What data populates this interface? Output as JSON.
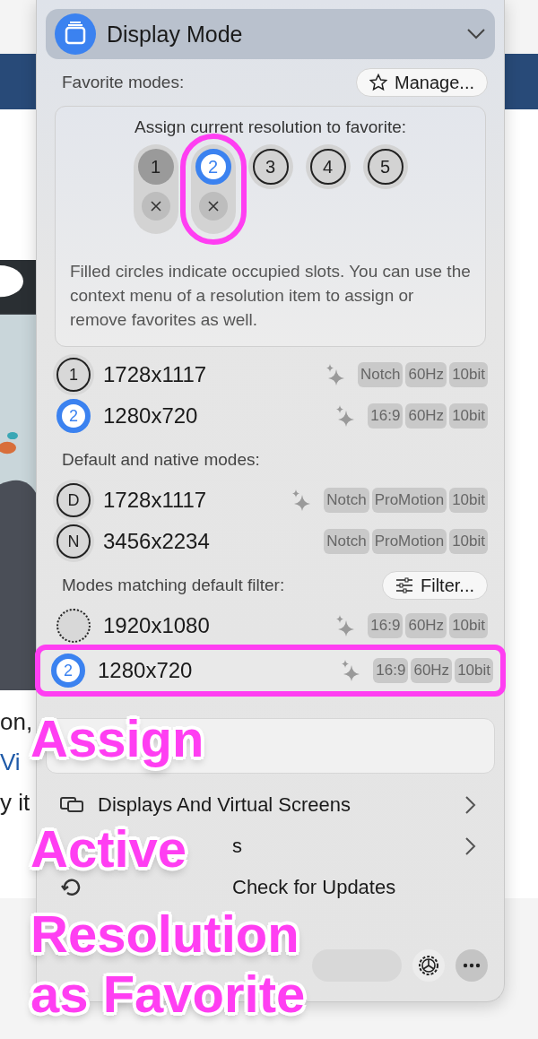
{
  "background": {
    "texts": [
      {
        "text": "on,",
        "kind": "plain"
      },
      {
        "text": "Vi",
        "kind": "link"
      },
      {
        "text": "y it",
        "kind": "plain"
      }
    ]
  },
  "header": {
    "title": "Display Mode",
    "expanded": true
  },
  "favorites": {
    "label": "Favorite modes:",
    "manage_button": "Manage...",
    "assign_title": "Assign current resolution to favorite:",
    "slots": [
      {
        "number": "1",
        "occupied": true,
        "selected": false,
        "highlighted": false
      },
      {
        "number": "2",
        "occupied": true,
        "selected": true,
        "highlighted": true
      },
      {
        "number": "3",
        "occupied": false,
        "selected": false,
        "highlighted": false
      },
      {
        "number": "4",
        "occupied": false,
        "selected": false,
        "highlighted": false
      },
      {
        "number": "5",
        "occupied": false,
        "selected": false,
        "highlighted": false
      }
    ],
    "hint": "Filled circles indicate occupied slots. You can use the context menu of a resolution item to assign or remove favorites as well."
  },
  "sections": [
    {
      "rows": [
        {
          "badge": "1",
          "kind": "outline",
          "highlighted": false,
          "resolution": "1728x1117",
          "sparkle": true,
          "tags": [
            "Notch",
            "60Hz",
            "10bit"
          ]
        },
        {
          "badge": "2",
          "kind": "active",
          "highlighted": false,
          "resolution": "1280x720",
          "sparkle": true,
          "tags": [
            "16:9",
            "60Hz",
            "10bit"
          ]
        }
      ]
    },
    {
      "label": "Default and native modes:",
      "rows": [
        {
          "badge": "D",
          "kind": "outline",
          "highlighted": false,
          "resolution": "1728x1117",
          "sparkle": true,
          "tags": [
            "Notch",
            "ProMotion",
            "10bit"
          ]
        },
        {
          "badge": "N",
          "kind": "outline",
          "highlighted": false,
          "resolution": "3456x2234",
          "sparkle": false,
          "tags": [
            "Notch",
            "ProMotion",
            "10bit"
          ]
        }
      ]
    },
    {
      "label": "Modes matching default filter:",
      "button": "Filter...",
      "rows": [
        {
          "kind": "dotted",
          "highlighted": false,
          "resolution": "1920x1080",
          "sparkle": true,
          "tags": [
            "16:9",
            "60Hz",
            "10bit"
          ]
        },
        {
          "badge": "2",
          "kind": "active",
          "highlighted": true,
          "resolution": "1280x720",
          "sparkle": true,
          "tags": [
            "16:9",
            "60Hz",
            "10bit"
          ]
        }
      ]
    }
  ],
  "menu": [
    {
      "label": "Displays And Virtual Screens",
      "submenu": true
    },
    {
      "label": "s",
      "submenu": true
    },
    {
      "label": "Check for Updates",
      "submenu": false
    }
  ],
  "caption": [
    "Assign",
    "Active",
    "Resolution",
    "as Favorite"
  ]
}
